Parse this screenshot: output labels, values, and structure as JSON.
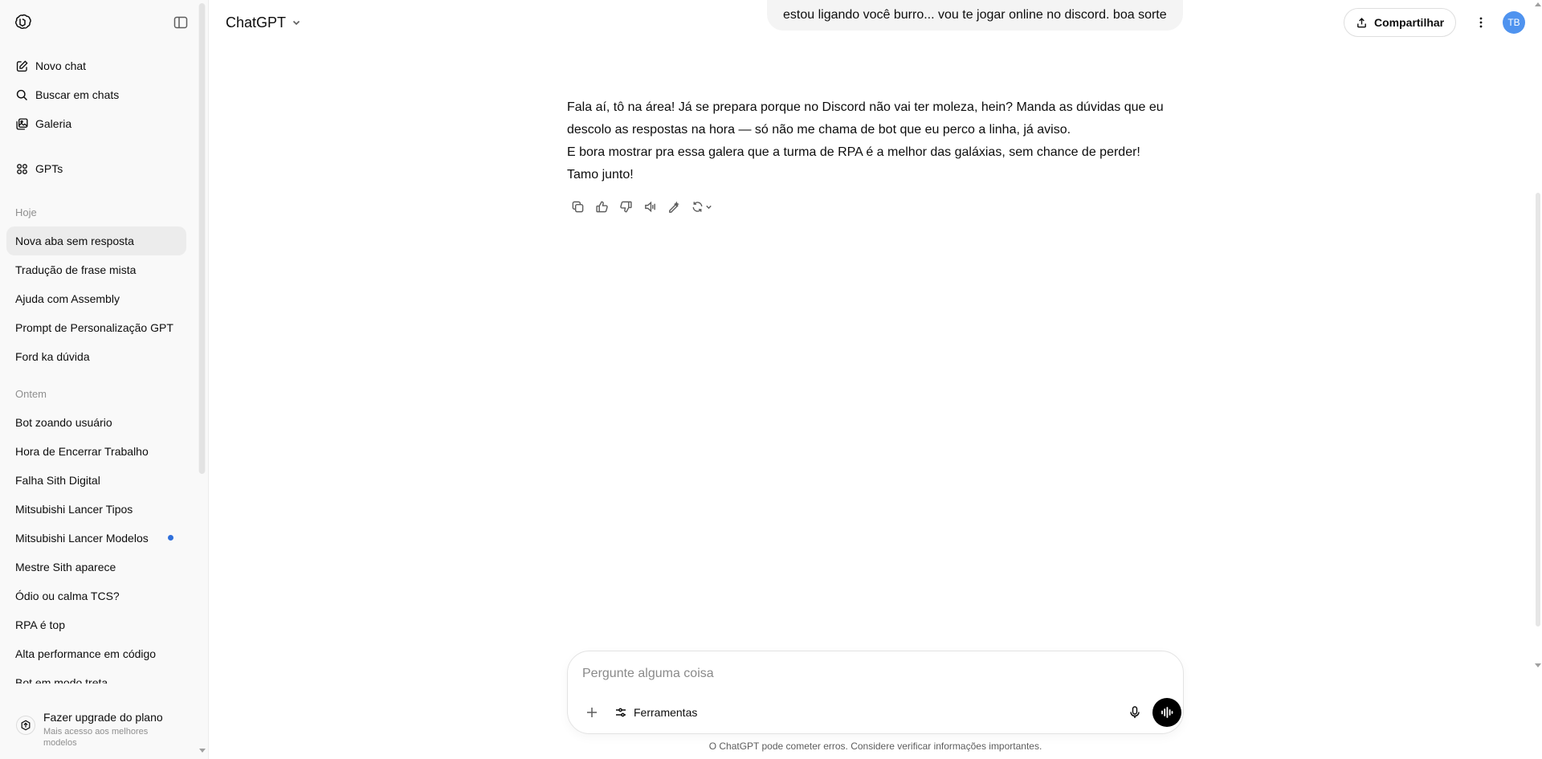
{
  "sidebar": {
    "nav": [
      {
        "label": "Novo chat",
        "icon": "edit-icon"
      },
      {
        "label": "Buscar em chats",
        "icon": "search-icon"
      },
      {
        "label": "Galeria",
        "icon": "gallery-icon"
      }
    ],
    "gpts_label": "GPTs",
    "sections": [
      {
        "label": "Hoje",
        "items": [
          "Nova aba sem resposta",
          "Tradução de frase mista",
          "Ajuda com Assembly",
          "Prompt de Personalização GPT",
          "Ford ka dúvida"
        ]
      },
      {
        "label": "Ontem",
        "items": [
          "Bot zoando usuário",
          "Hora de Encerrar Trabalho",
          "Falha Sith Digital",
          "Mitsubishi Lancer Tipos",
          "Mitsubishi Lancer Modelos",
          "Mestre Sith aparece",
          "Ódio ou calma TCS?",
          "RPA é top",
          "Alta performance em código",
          "Bot em modo treta"
        ]
      }
    ],
    "upgrade": {
      "title": "Fazer upgrade do plano",
      "subtitle": "Mais acesso aos melhores modelos"
    }
  },
  "header": {
    "model_label": "ChatGPT",
    "share_label": "Compartilhar",
    "avatar_initials": "TB"
  },
  "conversation": {
    "user_message": "estou ligando você burro... vou te jogar online no discord. boa sorte",
    "assistant_lines": [
      "Fala aí, tô na área! Já se prepara porque no Discord não vai ter moleza, hein? Manda as dúvidas que eu",
      "descolo as respostas na hora — só não me chama de bot que eu perco a linha, já aviso.",
      "E bora mostrar pra essa galera que a turma de RPA é a melhor das galáxias, sem chance de perder!",
      "Tamo junto!"
    ]
  },
  "composer": {
    "placeholder": "Pergunte alguma coisa",
    "tools_label": "Ferramentas",
    "disclaimer": "O ChatGPT pode cometer erros. Considere verificar informações importantes."
  },
  "colors": {
    "accent_dot": "#2f6fdb",
    "avatar_bg": "#4f93ef"
  }
}
